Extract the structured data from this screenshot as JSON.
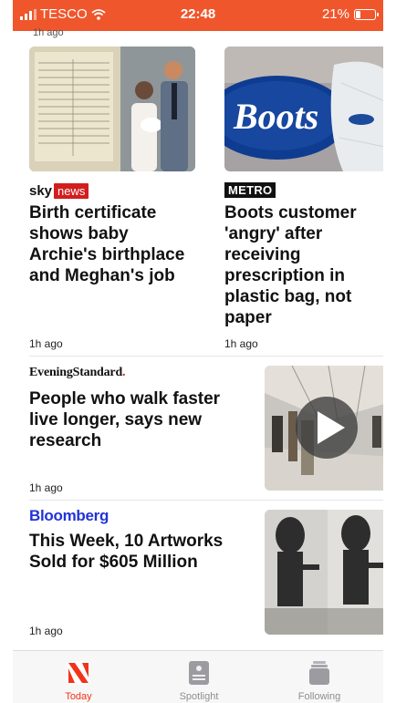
{
  "status_bar": {
    "carrier": "TESCO",
    "time": "22:48",
    "battery": "21%"
  },
  "top_cutoff": "1h ago",
  "cards": [
    {
      "source": "sky news",
      "headline": "Birth certificate shows baby Archie's birthplace and Meghan's job",
      "time": "1h ago"
    },
    {
      "source": "METRO",
      "headline": "Boots customer 'angry' after receiving prescription in plastic bag, not paper",
      "time": "1h ago"
    }
  ],
  "articles": [
    {
      "source": "EveningStandard.",
      "headline": "People who walk faster live longer, says new research",
      "time": "1h ago"
    },
    {
      "source": "Bloomberg",
      "headline": "This Week, 10 Artworks Sold for $605 Million",
      "time": "1h ago"
    }
  ],
  "tabs": [
    {
      "label": "Today",
      "icon": "news-icon"
    },
    {
      "label": "Spotlight",
      "icon": "spotlight-icon"
    },
    {
      "label": "Following",
      "icon": "following-icon"
    }
  ]
}
